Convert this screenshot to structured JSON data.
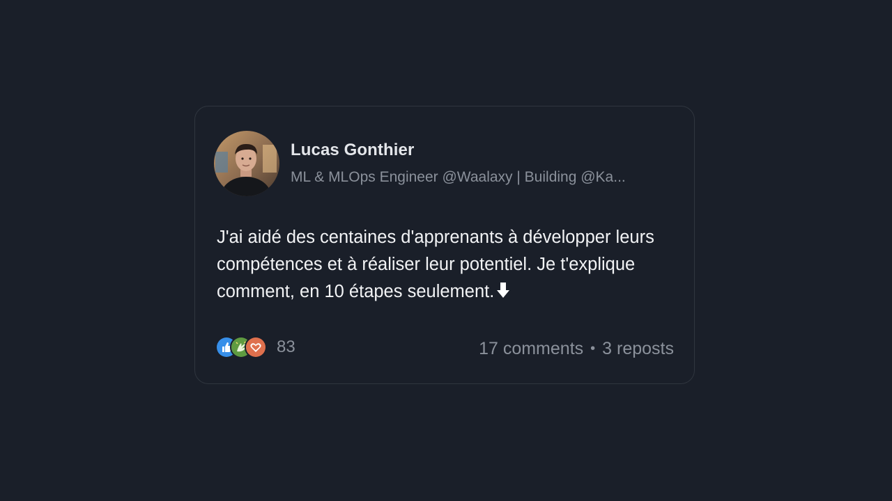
{
  "post": {
    "author_name": "Lucas Gonthier",
    "author_headline": "ML & MLOps Engineer @Waalaxy | Building @Ka...",
    "text": "J'ai aidé des centaines d'apprenants à développer leurs compétences et à réaliser leur potentiel. Je t'explique comment, en 10 étapes seulement.",
    "text_end_icon": "down-arrow-emoji",
    "reactions": {
      "icons": [
        "like-icon",
        "celebrate-icon",
        "love-icon"
      ],
      "count": "83"
    },
    "comments_label": "17 comments",
    "separator": "•",
    "reposts_label": "3 reposts"
  },
  "colors": {
    "background": "#1a1f29",
    "card_border": "#30363f",
    "name": "#e4e6ea",
    "muted": "#8b919b",
    "body_text": "#f2f3f5",
    "like": "#378fe9",
    "celebrate": "#5f9b41",
    "love": "#df704d"
  }
}
